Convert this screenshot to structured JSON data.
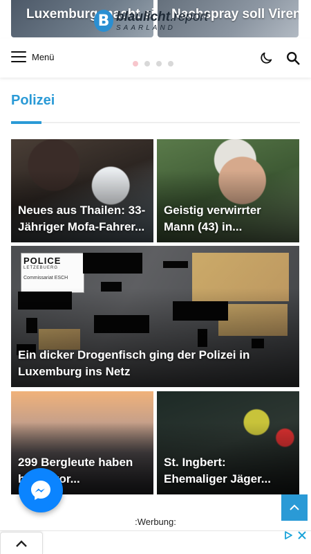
{
  "slider": {
    "left_title": "Luxemburg macht sich",
    "right_title": "Nachspray soll Viren in",
    "dots": 4,
    "active_dot": 0
  },
  "logo": {
    "main_bold": "blaulicht",
    "main_light": ".report",
    "sub": "SAARLAND"
  },
  "header": {
    "menu_label": "Menü",
    "icons": [
      "hamburger-icon",
      "moon-icon",
      "search-icon"
    ]
  },
  "section": {
    "title": "Polizei",
    "accent_color": "#2a9ad6"
  },
  "articles": [
    {
      "title": "Neues aus Thailen: 33-Jähriger Mofa-Fahrer..."
    },
    {
      "title": "Geistig verwirrter Mann (43) in..."
    },
    {
      "title": "Ein dicker Drogenfisch ging der Polizei in Luxemburg ins Netz",
      "image_text": {
        "police": "POLICE",
        "country": "LETZEBUERG",
        "office": "Commissariat ESCH"
      }
    },
    {
      "title": "299 Bergleute haben heute vor..."
    },
    {
      "title": "St. Ingbert: Ehemaliger Jäger..."
    }
  ],
  "ad": {
    "label": ":Werbung:"
  },
  "colors": {
    "messenger": "#0b84ff",
    "back_to_top": "#2a9ad6"
  }
}
